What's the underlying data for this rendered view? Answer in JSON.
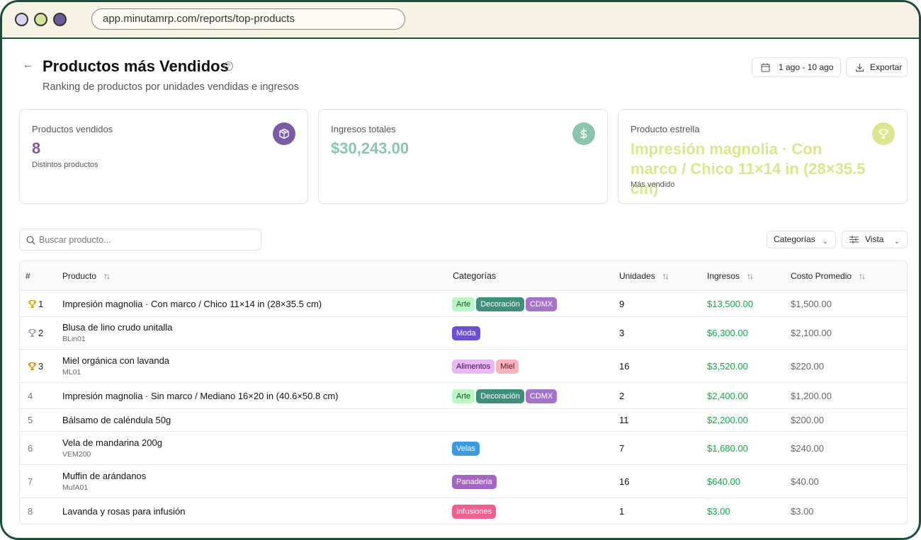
{
  "browser": {
    "url": "app.minutamrp.com/reports/top-products"
  },
  "header": {
    "title": "Productos más Vendidos",
    "help_glyph": "?",
    "subtitle": "Ranking de productos por unidades vendidas e ingresos",
    "date_range": "1 ago - 10 ago",
    "export_label": "Exportar"
  },
  "cards": [
    {
      "label": "Productos vendidos",
      "value": "8",
      "sub": "Distintos productos",
      "color": "#7b5ba6",
      "icon": "package-icon"
    },
    {
      "label": "Ingresos totales",
      "value": "$30,243.00",
      "sub": "",
      "color": "#8cc4b0",
      "icon": "dollar-icon"
    },
    {
      "label": "Producto estrella",
      "value": "Impresión magnolia · Con marco / Chico 11×14 in (28×35.5 cm)",
      "sub": "Más vendido",
      "color": "#dce58f",
      "icon": "trophy-icon"
    }
  ],
  "toolbar": {
    "search_placeholder": "Buscar producto...",
    "categories_label": "Categorías",
    "view_label": "Vista"
  },
  "table": {
    "headers": {
      "rank": "#",
      "product": "Producto",
      "categories": "Categorías",
      "units": "Unidades",
      "income": "Ingresos",
      "avg_cost": "Costo Promedio"
    },
    "rows": [
      {
        "rank": "1",
        "trophy": "gold",
        "name": "Impresión magnolia · Con marco / Chico 11×14 in (28×35.5 cm)",
        "sku": "",
        "tags": [
          {
            "label": "Arte",
            "bg": "#bbf7c4",
            "fg": "#14532d"
          },
          {
            "label": "Decoración",
            "bg": "#3f8f7a",
            "fg": "#ffffff"
          },
          {
            "label": "CDMX",
            "bg": "#a474c8",
            "fg": "#ffffff"
          }
        ],
        "units": "9",
        "income": "$13,500.00",
        "cost": "$1,500.00"
      },
      {
        "rank": "2",
        "trophy": "silver",
        "name": "Blusa de lino crudo unitalla",
        "sku": "BLin01",
        "tags": [
          {
            "label": "Moda",
            "bg": "#6d4fd6",
            "fg": "#ffffff"
          }
        ],
        "units": "3",
        "income": "$6,300.00",
        "cost": "$2,100.00"
      },
      {
        "rank": "3",
        "trophy": "bronze",
        "name": "Miel orgánica con lavanda",
        "sku": "ML01",
        "tags": [
          {
            "label": "Alimentos",
            "bg": "#e9b8f5",
            "fg": "#3b0a4a"
          },
          {
            "label": "Miel",
            "bg": "#f7b4bc",
            "fg": "#5b1020"
          }
        ],
        "units": "16",
        "income": "$3,520.00",
        "cost": "$220.00"
      },
      {
        "rank": "4",
        "trophy": "",
        "name": "Impresión magnolia · Sin marco / Mediano 16×20 in (40.6×50.8 cm)",
        "sku": "",
        "tags": [
          {
            "label": "Arte",
            "bg": "#bbf7c4",
            "fg": "#14532d"
          },
          {
            "label": "Decoración",
            "bg": "#3f8f7a",
            "fg": "#ffffff"
          },
          {
            "label": "CDMX",
            "bg": "#a474c8",
            "fg": "#ffffff"
          }
        ],
        "units": "2",
        "income": "$2,400.00",
        "cost": "$1,200.00"
      },
      {
        "rank": "5",
        "trophy": "",
        "name": "Bálsamo de caléndula 50g",
        "sku": "",
        "tags": [],
        "units": "11",
        "income": "$2,200.00",
        "cost": "$200.00"
      },
      {
        "rank": "6",
        "trophy": "",
        "name": "Vela de mandarina 200g",
        "sku": "VEM200",
        "tags": [
          {
            "label": "Velas",
            "bg": "#3a9be0",
            "fg": "#ffffff"
          }
        ],
        "units": "7",
        "income": "$1,680.00",
        "cost": "$240.00"
      },
      {
        "rank": "7",
        "trophy": "",
        "name": "Muffin de arándanos",
        "sku": "MufA01",
        "tags": [
          {
            "label": "Panadería",
            "bg": "#a466c0",
            "fg": "#ffffff"
          }
        ],
        "units": "16",
        "income": "$640.00",
        "cost": "$40.00"
      },
      {
        "rank": "8",
        "trophy": "",
        "name": "Lavanda y rosas para infusión",
        "sku": "",
        "tags": [
          {
            "label": "Infusiones",
            "bg": "#f0608e",
            "fg": "#ffffff"
          }
        ],
        "units": "1",
        "income": "$3.00",
        "cost": "$3.00"
      }
    ]
  }
}
